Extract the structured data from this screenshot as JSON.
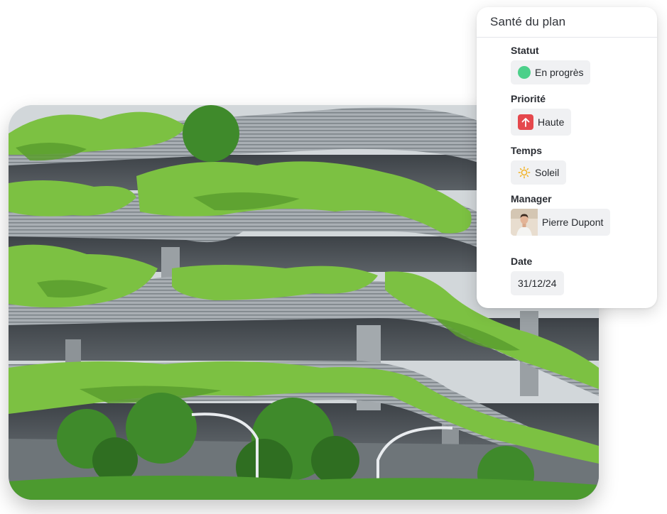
{
  "panel": {
    "title": "Santé du plan",
    "fields": {
      "status": {
        "label": "Statut",
        "value": "En progrès",
        "color": "#4cd08a"
      },
      "priority": {
        "label": "Priorité",
        "value": "Haute",
        "color": "#e5484d"
      },
      "weather": {
        "label": "Temps",
        "value": "Soleil",
        "color": "#f2b01e"
      },
      "manager": {
        "label": "Manager",
        "value": "Pierre Dupont"
      },
      "date": {
        "label": "Date",
        "value": "31/12/24"
      }
    }
  },
  "icons": {
    "status": "status-dot-icon",
    "priority": "arrow-up-icon",
    "weather": "sun-icon",
    "manager": "avatar"
  }
}
